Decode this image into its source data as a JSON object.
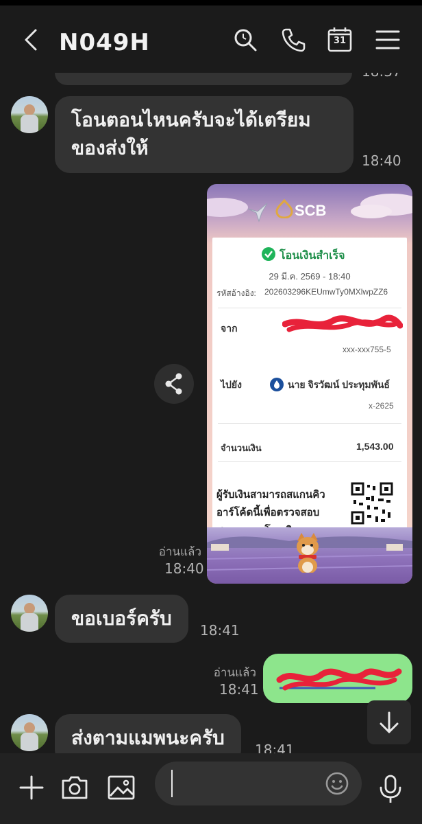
{
  "header": {
    "title": "N049H",
    "back_icon": "chevron-left-icon",
    "search_icon": "search-icon",
    "call_icon": "phone-icon",
    "calendar_icon": "calendar-icon",
    "calendar_day": "31",
    "menu_icon": "hamburger-menu-icon"
  },
  "messages": {
    "prev_time": "18:37",
    "m1": {
      "text_line1": "โอนตอนไหนครับจะได้เตรียม",
      "text_line2": "ของส่งให้",
      "time": "18:40"
    },
    "receipt": {
      "read": "อ่านแล้ว",
      "time": "18:40",
      "bank": "SCB",
      "status": "โอนเงินสำเร็จ",
      "datetime": "29 มี.ค. 2569 - 18:40",
      "ref_label": "รหัสอ้างอิง:",
      "ref_value": "202603296KEUmwTy0MXlwpZZ6",
      "from_label": "จาก",
      "from_account": "xxx-xxx755-5",
      "to_label": "ไปยัง",
      "to_name": "นาย จิรวัฒน์ ประทุมพันธ์",
      "to_account": "x-2625",
      "amount_label": "จำนวนเงิน",
      "amount_value": "1,543.00",
      "qr_line1": "ผู้รับเงินสามารถสแกนคิว",
      "qr_line2": "อาร์โค้ดนี้เพื่อตรวจสอบ",
      "qr_line3": "สถานะการโอนเงิน"
    },
    "m2": {
      "text": "ขอเบอร์ครับ",
      "time": "18:41"
    },
    "m3": {
      "read": "อ่านแล้ว",
      "time": "18:41"
    },
    "m4": {
      "text": "ส่งตามแมพนะครับ",
      "time": "18:41"
    }
  },
  "bottom_bar": {
    "plus_icon": "plus-icon",
    "camera_icon": "camera-icon",
    "image_icon": "image-icon",
    "emoji_icon": "emoji-icon",
    "mic_icon": "microphone-icon",
    "input_value": ""
  },
  "colors": {
    "background": "#1b1b1b",
    "incoming_bubble": "#333333",
    "outgoing_bubble": "#8de58c",
    "success_green": "#1fb45a",
    "scb_gold": "#e0a840",
    "scrawl_red": "#e8223a"
  }
}
